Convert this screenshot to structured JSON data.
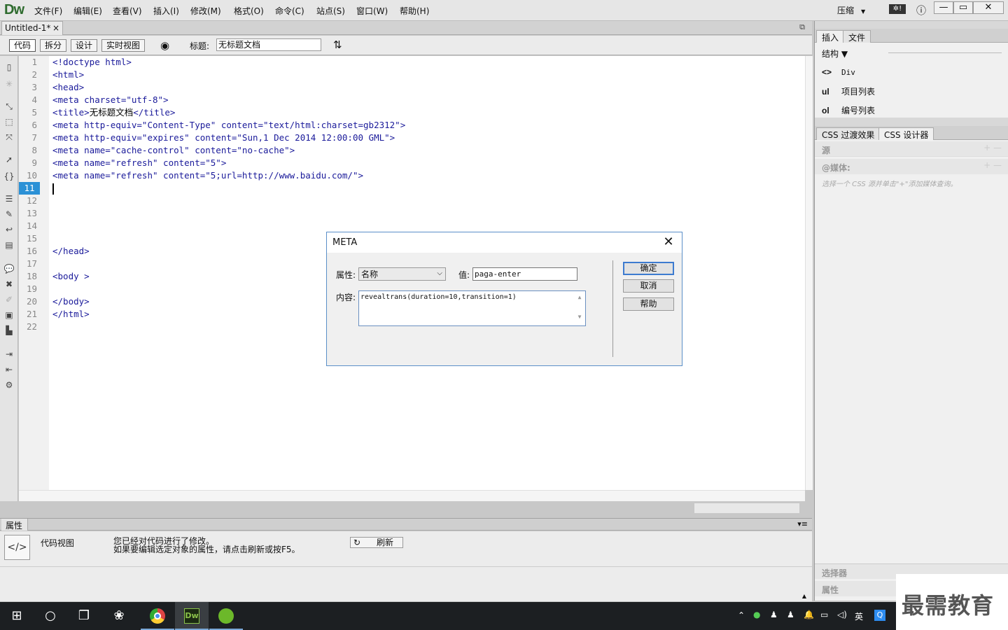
{
  "app": {
    "logo": "Dw",
    "menus": [
      "文件(F)",
      "编辑(E)",
      "查看(V)",
      "插入(I)",
      "修改(M)",
      "格式(O)",
      "命令(C)",
      "站点(S)",
      "窗口(W)",
      "帮助(H)"
    ],
    "compress": "压缩",
    "min": "—",
    "max": "▭",
    "close": "✕"
  },
  "doc": {
    "tab": "Untitled-1*",
    "tab_close": "×"
  },
  "toolbar": {
    "views": [
      "代码",
      "拆分",
      "设计",
      "实时视图"
    ],
    "title_label": "标题:",
    "title_value": "无标题文档"
  },
  "code": {
    "line_numbers": [
      "1",
      "2",
      "3",
      "4",
      "5",
      "6",
      "7",
      "8",
      "9",
      "10",
      "11",
      "12",
      "13",
      "14",
      "15",
      "16",
      "17",
      "18",
      "19",
      "20",
      "21",
      "22"
    ],
    "current_line": "11",
    "lines": [
      "<!doctype html>",
      "<html>",
      "<head>",
      "<meta charset=\"utf-8\">",
      "",
      "<meta http-equiv=\"Content-Type\" content=\"text/html:charset=gb2312\">",
      "<meta http-equiv=\"expires\" content=\"Sun,1 Dec 2014 12:00:00 GML\">",
      "<meta name=\"cache-control\" content=\"no-cache\">",
      "<meta name=\"refresh\" content=\"5\">",
      "<meta name=\"refresh\" content=\"5;url=http://www.baidu.com/\">",
      "",
      "",
      "",
      "",
      "",
      "</head>",
      "",
      "<body >",
      "",
      "</body>",
      "</html>",
      ""
    ],
    "title_open": "<title>",
    "title_text": "无标题文档",
    "title_close": "</title>"
  },
  "dialog": {
    "title": "META",
    "close": "✕",
    "attr_label": "属性:",
    "attr_value": "名称",
    "value_label": "值:",
    "value": "paga-enter",
    "content_label": "内容:",
    "content": "revealtrans(duration=10,transition=1)",
    "ok": "确定",
    "cancel": "取消",
    "help": "帮助"
  },
  "properties": {
    "tab": "属性",
    "view_label": "代码视图",
    "msg1": "您已经对代码进行了修改。",
    "msg2": "如果要编辑选定对象的属性，请点击刷新或按F5。",
    "refresh": "刷新"
  },
  "right_panel": {
    "tabs1": [
      "插入",
      "文件"
    ],
    "category": "结构",
    "items": [
      {
        "icon": "<>",
        "label": "Div"
      },
      {
        "icon": "ul",
        "label": "项目列表"
      },
      {
        "icon": "ol",
        "label": "编号列表"
      }
    ],
    "tabs2": [
      "CSS 过渡效果",
      "CSS 设计器"
    ],
    "source": "源",
    "media": "@媒体:",
    "media_hint": "选择一个 CSS 源并单击\"+\"添加媒体查询。",
    "selector": "选择器",
    "prop": "属性"
  },
  "taskbar": {
    "lang": "英"
  },
  "brand": {
    "text": "最需教育"
  }
}
